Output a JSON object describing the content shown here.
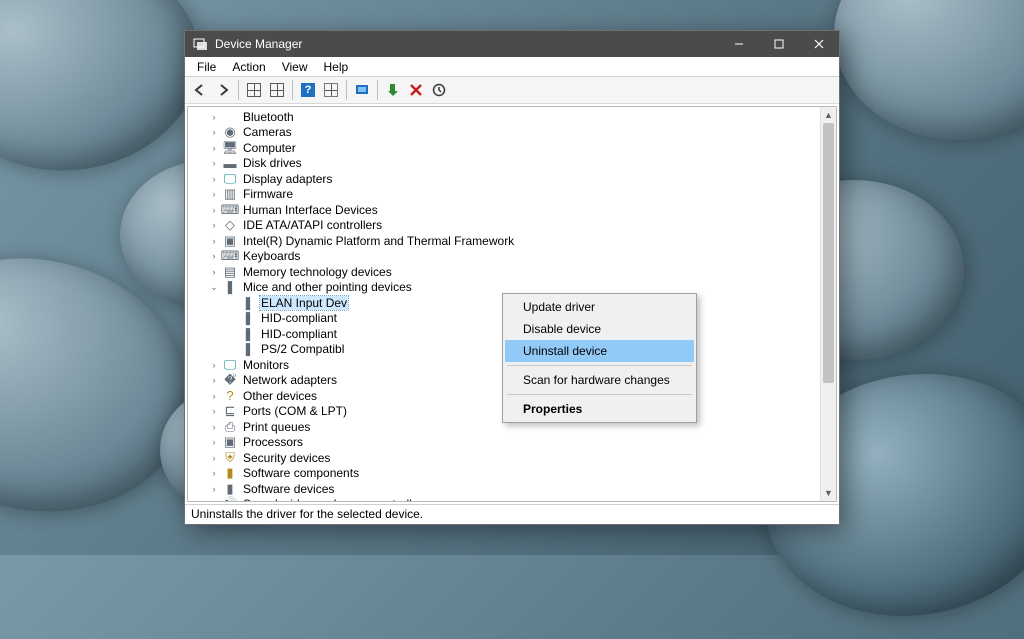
{
  "window": {
    "title": "Device Manager"
  },
  "menu": {
    "file": "File",
    "action": "Action",
    "view": "View",
    "help": "Help"
  },
  "tree": {
    "items": [
      {
        "label": "Bluetooth",
        "icon": "bluetooth-icon",
        "glyph": "",
        "cls": "ic-blue"
      },
      {
        "label": "Cameras",
        "icon": "camera-icon",
        "glyph": "◉",
        "cls": "ic-gray"
      },
      {
        "label": "Computer",
        "icon": "computer-icon",
        "glyph": "🖥",
        "cls": "ic-gray"
      },
      {
        "label": "Disk drives",
        "icon": "disk-icon",
        "glyph": "▬",
        "cls": "ic-gray"
      },
      {
        "label": "Display adapters",
        "icon": "display-icon",
        "glyph": "🖵",
        "cls": "ic-teal"
      },
      {
        "label": "Firmware",
        "icon": "firmware-icon",
        "glyph": "▥",
        "cls": "ic-gray"
      },
      {
        "label": "Human Interface Devices",
        "icon": "hid-icon",
        "glyph": "⌨",
        "cls": "ic-gray"
      },
      {
        "label": "IDE ATA/ATAPI controllers",
        "icon": "ide-icon",
        "glyph": "◇",
        "cls": "ic-gray"
      },
      {
        "label": "Intel(R) Dynamic Platform and Thermal Framework",
        "icon": "chip-icon",
        "glyph": "▣",
        "cls": "ic-gray"
      },
      {
        "label": "Keyboards",
        "icon": "keyboard-icon",
        "glyph": "⌨",
        "cls": "ic-gray"
      },
      {
        "label": "Memory technology devices",
        "icon": "memory-icon",
        "glyph": "▤",
        "cls": "ic-gray"
      }
    ],
    "expanded_label": "Mice and other pointing devices",
    "expanded_children": [
      {
        "label": "ELAN Input Dev",
        "selected": true
      },
      {
        "label": "HID-compliant"
      },
      {
        "label": "HID-compliant"
      },
      {
        "label": "PS/2 Compatibl"
      }
    ],
    "items_after": [
      {
        "label": "Monitors",
        "icon": "monitor-icon",
        "glyph": "🖵",
        "cls": "ic-teal"
      },
      {
        "label": "Network adapters",
        "icon": "network-icon",
        "glyph": "�් ",
        "cls": "ic-gray"
      },
      {
        "label": "Other devices",
        "icon": "other-icon",
        "glyph": "?",
        "cls": "ic-yellow"
      },
      {
        "label": "Ports (COM & LPT)",
        "icon": "ports-icon",
        "glyph": "⊑",
        "cls": "ic-gray"
      },
      {
        "label": "Print queues",
        "icon": "print-icon",
        "glyph": "⎙",
        "cls": "ic-gray"
      },
      {
        "label": "Processors",
        "icon": "cpu-icon",
        "glyph": "▣",
        "cls": "ic-gray"
      },
      {
        "label": "Security devices",
        "icon": "security-icon",
        "glyph": "⛨",
        "cls": "ic-yellow"
      },
      {
        "label": "Software components",
        "icon": "softcomp-icon",
        "glyph": "▮",
        "cls": "ic-yellow"
      },
      {
        "label": "Software devices",
        "icon": "softdev-icon",
        "glyph": "▮",
        "cls": "ic-gray"
      },
      {
        "label": "Sound, video and game controllers",
        "icon": "sound-icon",
        "glyph": "🔊",
        "cls": "ic-gray"
      }
    ]
  },
  "context": {
    "update": "Update driver",
    "disable": "Disable device",
    "uninstall": "Uninstall device",
    "scan": "Scan for hardware changes",
    "properties": "Properties"
  },
  "status": "Uninstalls the driver for the selected device."
}
